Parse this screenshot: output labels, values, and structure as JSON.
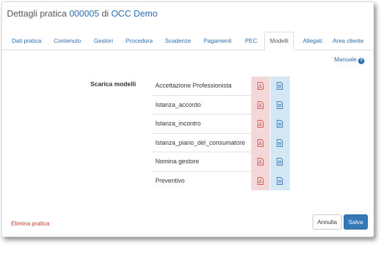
{
  "header": {
    "title_prefix": "Dettagli pratica ",
    "practice_number": "000005",
    "title_middle": " di ",
    "organization": "OCC Demo"
  },
  "tabs": [
    {
      "id": "dati-pratica",
      "label": "Dati pratica"
    },
    {
      "id": "contenuto",
      "label": "Contenuto"
    },
    {
      "id": "gestori",
      "label": "Gestori"
    },
    {
      "id": "procedura",
      "label": "Procedura"
    },
    {
      "id": "scadenze",
      "label": "Scadenze"
    },
    {
      "id": "pagamenti",
      "label": "Pagamenti"
    },
    {
      "id": "pec",
      "label": "PEC"
    },
    {
      "id": "modelli",
      "label": "Modelli",
      "active": true
    },
    {
      "id": "allegati",
      "label": "Allegati"
    },
    {
      "id": "area-cliente",
      "label": "Area cliente"
    }
  ],
  "help": {
    "label": "Manuale",
    "icon": "question-circle-icon"
  },
  "download": {
    "label": "Scarica modelli",
    "pdf_icon": "pdf-file-icon",
    "doc_icon": "document-file-icon",
    "pdf_color": "#d9534f",
    "doc_color": "#3a78b6",
    "models": [
      {
        "name": "Accettazione Professionista"
      },
      {
        "name": "Istanza_accordo"
      },
      {
        "name": "Istanza_incontro"
      },
      {
        "name": "Istanza_piano_del_consumatore"
      },
      {
        "name": "Nomina gestore"
      },
      {
        "name": "Preventivo"
      }
    ]
  },
  "footer": {
    "delete_label": "Elimina pratica",
    "cancel_label": "Annulla",
    "save_label": "Salva"
  },
  "colors": {
    "accent": "#2a6bb0",
    "danger": "#c0392b",
    "primary_button": "#3478b8"
  }
}
